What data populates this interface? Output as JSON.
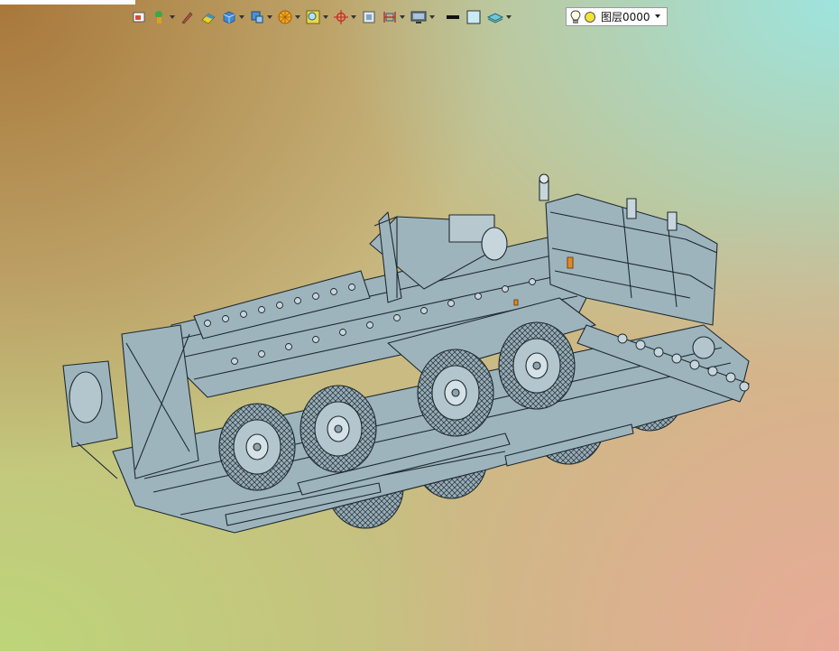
{
  "toolbar": {
    "buttons": [
      {
        "name": "view-icon"
      },
      {
        "name": "layer-manager-icon"
      },
      {
        "name": "pen-icon"
      },
      {
        "name": "eraser-icon"
      },
      {
        "name": "solid-box-icon"
      },
      {
        "name": "display-mode-icon"
      },
      {
        "name": "render-icon"
      },
      {
        "name": "zoom-fit-icon"
      },
      {
        "name": "origin-icon"
      },
      {
        "name": "frame-icon"
      },
      {
        "name": "section-icon"
      },
      {
        "name": "monitor-icon"
      },
      {
        "name": "line-weight-icon"
      },
      {
        "name": "color-swatch-icon"
      },
      {
        "name": "layer-stack-icon"
      }
    ]
  },
  "layer": {
    "current": "图层0000"
  },
  "colors": {
    "model_fill": "#9db4bd",
    "model_stroke": "#1f2a30",
    "accent_orange": "#e08a25",
    "layer_bulb": "#f2e33a"
  }
}
